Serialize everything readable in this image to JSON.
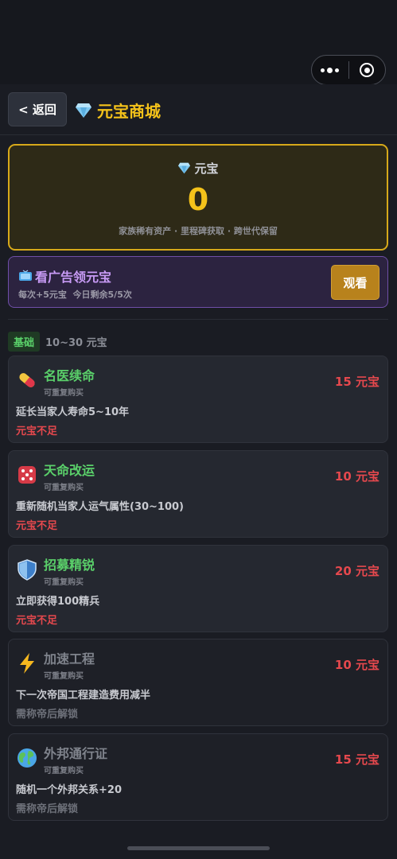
{
  "header": {
    "back_label": "< 返回",
    "title": "元宝商城"
  },
  "balance": {
    "label": "元宝",
    "value": "0",
    "desc": "家族稀有资产 · 里程碑获取 · 跨世代保留"
  },
  "ad": {
    "title": "看广告领元宝",
    "subtitle": "每次+5元宝  今日剩余5/5次",
    "button_label": "观看"
  },
  "section": {
    "tier": "基础",
    "range": "10~30 元宝"
  },
  "items": [
    {
      "name": "名医续命",
      "repeat": "可重复购买",
      "price": "15 元宝",
      "desc": "延长当家人寿命5~10年",
      "status": "元宝不足",
      "icon": "pill-icon",
      "locked": false
    },
    {
      "name": "天命改运",
      "repeat": "可重复购买",
      "price": "10 元宝",
      "desc": "重新随机当家人运气属性(30~100)",
      "status": "元宝不足",
      "icon": "dice-icon",
      "locked": false
    },
    {
      "name": "招募精锐",
      "repeat": "可重复购买",
      "price": "20 元宝",
      "desc": "立即获得100精兵",
      "status": "元宝不足",
      "icon": "shield-icon",
      "locked": false
    },
    {
      "name": "加速工程",
      "repeat": "可重复购买",
      "price": "10 元宝",
      "desc": "下一次帝国工程建造费用减半",
      "status": "需称帝后解锁",
      "icon": "lightning-icon",
      "locked": true
    },
    {
      "name": "外邦通行证",
      "repeat": "可重复购买",
      "price": "15 元宝",
      "desc": "随机一个外邦关系+20",
      "status": "需称帝后解锁",
      "icon": "globe-icon",
      "locked": true
    }
  ],
  "colors": {
    "gold": "#f4c21a",
    "green": "#5ad06a",
    "red": "#e5484d",
    "purple": "#c79af4"
  }
}
